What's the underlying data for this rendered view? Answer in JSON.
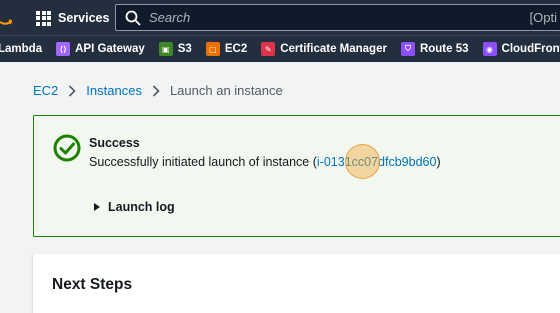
{
  "nav": {
    "services_label": "Services",
    "search_placeholder": "Search",
    "search_option_hint": "[Opti"
  },
  "favorites": [
    {
      "label": "Lambda",
      "icon": "lambda-icon",
      "color": ""
    },
    {
      "label": "API Gateway",
      "icon": "api-gateway-icon",
      "color": "#a166ff"
    },
    {
      "label": "S3",
      "icon": "s3-icon",
      "color": "#3f8624"
    },
    {
      "label": "EC2",
      "icon": "ec2-icon",
      "color": "#ed7100"
    },
    {
      "label": "Certificate Manager",
      "icon": "certificate-manager-icon",
      "color": "#dd344c"
    },
    {
      "label": "Route 53",
      "icon": "route53-icon",
      "color": "#8c4fff"
    },
    {
      "label": "CloudFront",
      "icon": "cloudfront-icon",
      "color": "#8c4fff"
    },
    {
      "label": "",
      "icon": "service-icon",
      "color": "#ed7100"
    }
  ],
  "breadcrumb": {
    "items": [
      "EC2",
      "Instances"
    ],
    "current": "Launch an instance"
  },
  "flash": {
    "title": "Success",
    "message_prefix": "Successfully initiated launch of instance (",
    "instance_id": "i-0131cc07dfcb9bd60",
    "message_suffix": ")",
    "launch_log": "Launch log"
  },
  "next_steps": {
    "title": "Next Steps"
  },
  "colors": {
    "nav_bg": "#232f3e",
    "link": "#0073bb",
    "success": "#1d8102",
    "success_bg": "#f2f8f0"
  }
}
